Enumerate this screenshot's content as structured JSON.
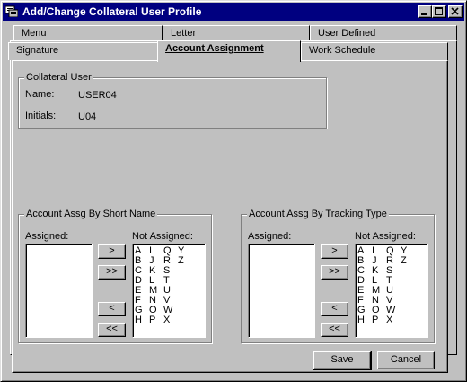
{
  "window": {
    "title": "Add/Change Collateral User Profile"
  },
  "tabs": {
    "menu": "Menu",
    "letter": "Letter",
    "user_defined": "User Defined",
    "signature": "Signature",
    "account_assignment": "Account Assignment",
    "work_schedule": "Work Schedule"
  },
  "collateral_user": {
    "title": "Collateral User",
    "name_label": "Name:",
    "name_value": "USER04",
    "initials_label": "Initials:",
    "initials_value": "U04"
  },
  "short_name": {
    "title": "Account Assg By Short Name",
    "assigned_label": "Assigned:",
    "not_assigned_label": "Not Assigned:",
    "not_assigned_rows": [
      [
        "A",
        "I",
        "Q",
        "Y"
      ],
      [
        "B",
        "J",
        "R",
        "Z"
      ],
      [
        "C",
        "K",
        "S",
        ""
      ],
      [
        "D",
        "L",
        "T",
        ""
      ],
      [
        "E",
        "M",
        "U",
        ""
      ],
      [
        "F",
        "N",
        "V",
        ""
      ],
      [
        "G",
        "O",
        "W",
        ""
      ],
      [
        "H",
        "P",
        "X",
        ""
      ]
    ]
  },
  "tracking_type": {
    "title": "Account Assg By Tracking Type",
    "assigned_label": "Assigned:",
    "not_assigned_label": "Not Assigned:",
    "not_assigned_rows": [
      [
        "A",
        "I",
        "Q",
        "Y"
      ],
      [
        "B",
        "J",
        "R",
        "Z"
      ],
      [
        "C",
        "K",
        "S",
        ""
      ],
      [
        "D",
        "L",
        "T",
        ""
      ],
      [
        "E",
        "M",
        "U",
        ""
      ],
      [
        "F",
        "N",
        "V",
        ""
      ],
      [
        "G",
        "O",
        "W",
        ""
      ],
      [
        "H",
        "P",
        "X",
        ""
      ]
    ]
  },
  "buttons": {
    "add_one": ">",
    "add_all": ">>",
    "remove_one": "<",
    "remove_all": "<<",
    "save": "Save",
    "cancel": "Cancel"
  }
}
